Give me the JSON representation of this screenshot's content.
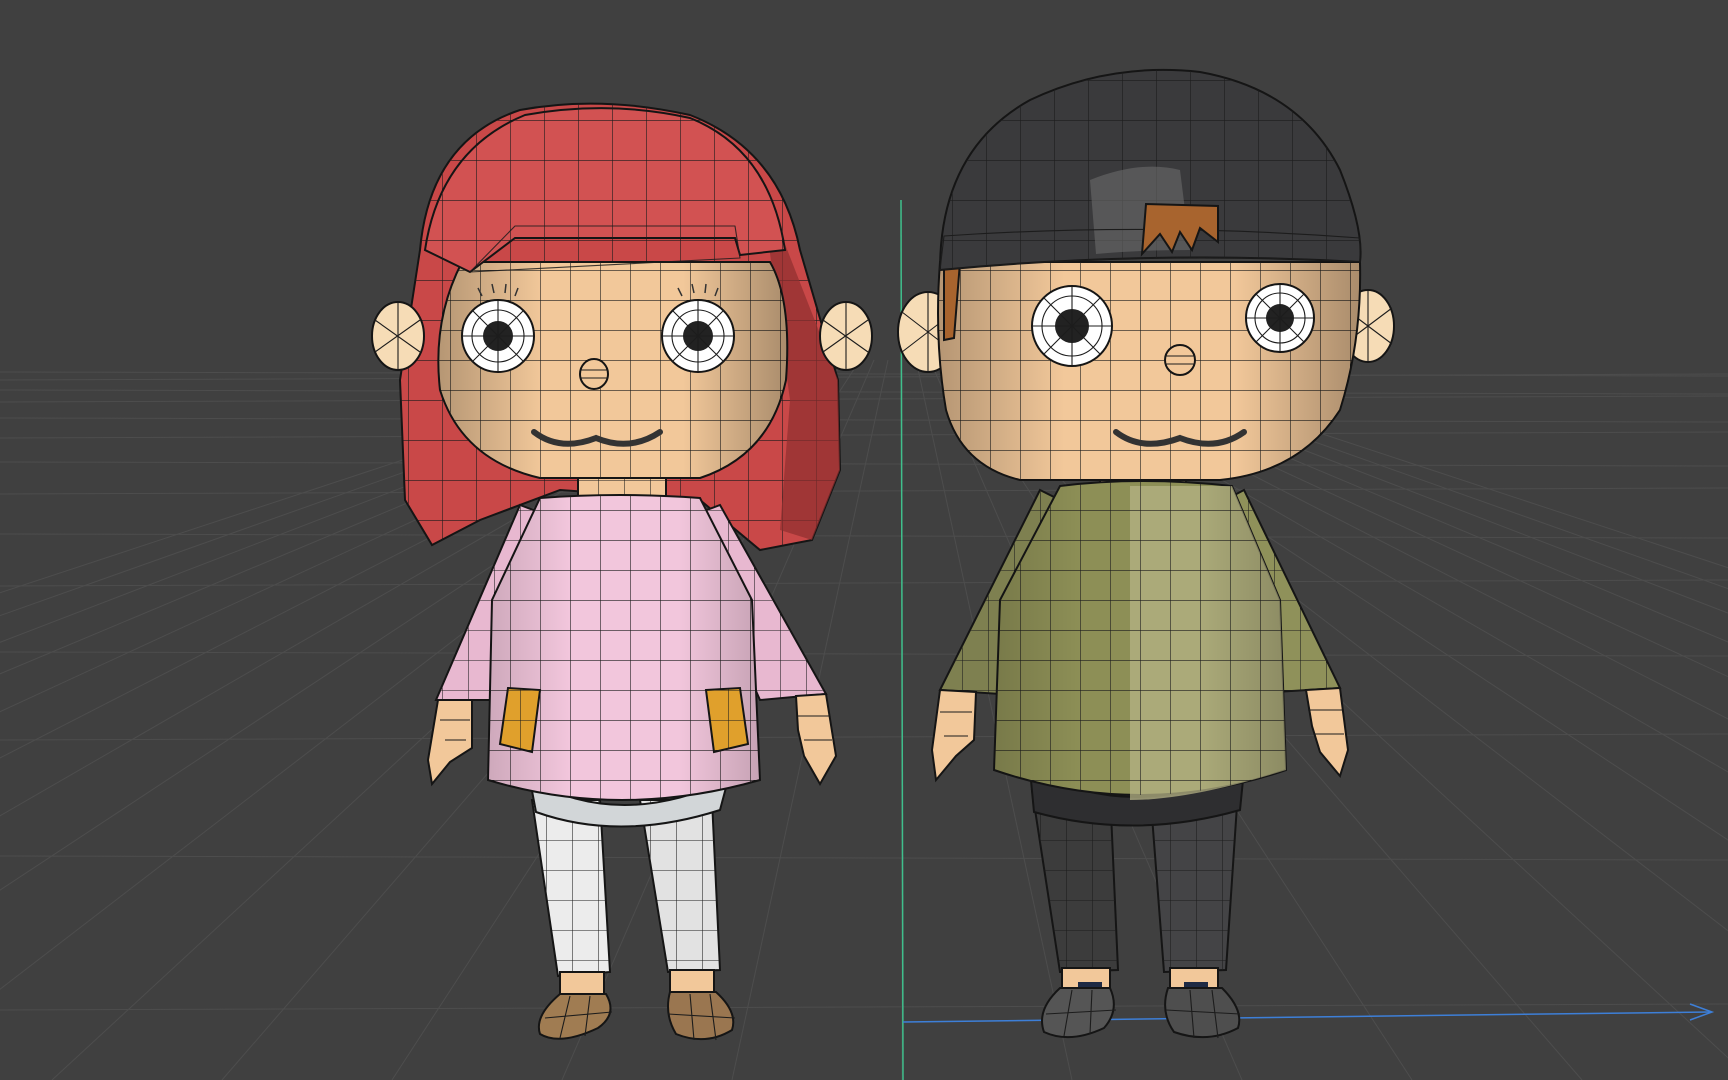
{
  "viewport": {
    "mode": "wireframe-shaded",
    "background": "#404040",
    "grid_color": "#4d4d4d",
    "grid": true,
    "axis_y_color": "#3fbf8c",
    "axis_x_color": "#3d7fd8"
  },
  "models": [
    {
      "name": "girl-character",
      "hair_color": "#c94848",
      "skin_color": "#f2c89a",
      "shirt_color": "#f2c6dc",
      "pocket_color": "#e0a02c",
      "pants_color": "#ececec",
      "shoe_color": "#a07c52"
    },
    {
      "name": "boy-character",
      "beanie_color": "#3a3a3c",
      "fringe_color": "#a8642e",
      "skin_color": "#f2c89a",
      "shirt_color": "#8d8f56",
      "pants_color": "#3c3c3c",
      "shoe_color": "#555555"
    }
  ]
}
